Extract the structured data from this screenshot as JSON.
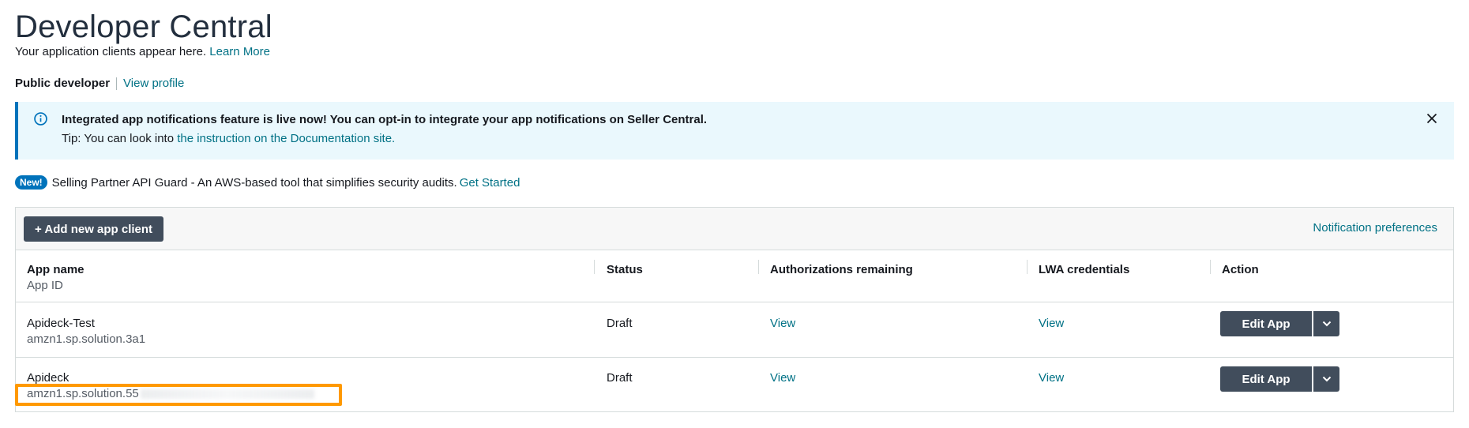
{
  "page": {
    "title": "Developer Central",
    "subtitle_text": "Your application clients appear here.",
    "learn_more": "Learn More"
  },
  "developer": {
    "type_label": "Public developer",
    "view_profile": "View profile"
  },
  "banner": {
    "headline": "Integrated app notifications feature is live now! You can opt-in to integrate your app notifications on Seller Central.",
    "tip_prefix": "Tip: You can look into",
    "tip_link": "the instruction on the Documentation site.",
    "info_icon": "info-icon",
    "close_icon": "close-icon"
  },
  "promo": {
    "badge": "New!",
    "text": "Selling Partner API Guard - An AWS-based tool that simplifies security audits.",
    "link": "Get Started"
  },
  "toolbar": {
    "add_button": "+ Add new app client",
    "notification_preferences": "Notification preferences"
  },
  "table": {
    "headers": {
      "app_name": "App name",
      "app_id": "App ID",
      "status": "Status",
      "authorizations": "Authorizations remaining",
      "lwa": "LWA credentials",
      "action": "Action"
    },
    "rows": [
      {
        "name": "Apideck-Test",
        "app_id": "amzn1.sp.solution.3a1",
        "status": "Draft",
        "authorizations": "View",
        "lwa": "View",
        "action": "Edit App"
      },
      {
        "name": "Apideck",
        "app_id": "amzn1.sp.solution.55",
        "status": "Draft",
        "authorizations": "View",
        "lwa": "View",
        "action": "Edit App"
      }
    ]
  },
  "colors": {
    "accent_link": "#007185",
    "button_dark": "#414d5c",
    "banner_bg": "#eaf8fd",
    "banner_border": "#0073bb",
    "highlight": "#ff9900"
  }
}
